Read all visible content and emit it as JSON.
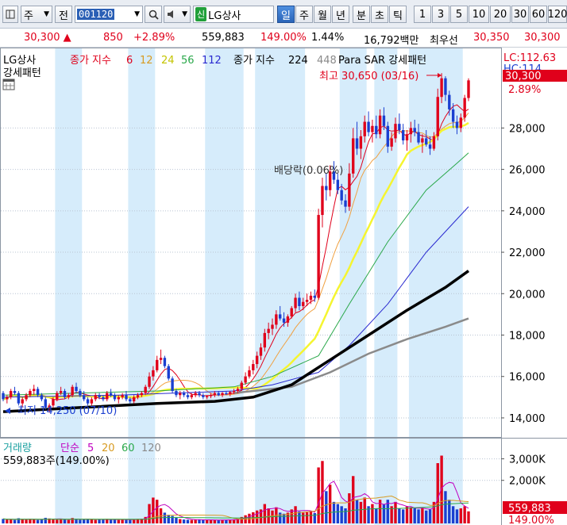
{
  "toolbar": {
    "code_type": "주",
    "prefix_btn": "전",
    "stock_code": "001120",
    "search_icon": "search-icon",
    "sound_icon": "speaker-icon",
    "credit_badge": "신",
    "stock_name": "LG상사",
    "periods": [
      "일",
      "주",
      "월",
      "년",
      "분",
      "초",
      "틱"
    ],
    "active_period": "일",
    "minute_counts": [
      "1",
      "3",
      "5",
      "10",
      "20",
      "30",
      "60",
      "120"
    ]
  },
  "quote": {
    "price": "30,300",
    "change": "850",
    "change_pct": "+2.89%",
    "volume": "559,883",
    "volume_ratio": "149.00%",
    "turnover_pct": "1.44%",
    "amount": "16,792백만",
    "best_ask_label": "최우선",
    "best_ask": "30,350",
    "best_bid": "30,300"
  },
  "colors": {
    "up": "#e0001b",
    "down": "#1a3fd0",
    "band": "#d6ecfb",
    "ma6": "#e0001b",
    "ma12": "#f0a040",
    "ma24": "#f5f530",
    "ma56": "#2aa84a",
    "ma112": "#2a2ad0",
    "ma224": "#000000",
    "ma448": "#8a8a8a"
  },
  "chart_data": [
    {
      "type": "candlestick",
      "title": "LG상사",
      "subtitle": "강세패턴",
      "legend": {
        "close_ma_label": "종가 지수",
        "periods_short": [
          "6",
          "12",
          "24",
          "56",
          "112"
        ],
        "close_ma_label_long": "종가 지수",
        "period_long": "224",
        "period_448": "448",
        "sar_label": "Para SAR 강세패턴"
      },
      "y_axis": {
        "ticks": [
          "28,000",
          "26,000",
          "24,000",
          "22,000",
          "20,000",
          "18,000",
          "16,000",
          "14,000"
        ],
        "range": [
          13500,
          31500
        ]
      },
      "right_labels": {
        "lc": "LC:112.63",
        "hc": "HC:114",
        "price": "30,300",
        "pct": "2.89%"
      },
      "annotations": {
        "high": "최고 30,650 (03/16)",
        "low": "최저 14,250 (07/10)",
        "dividend": "배당락(0.06%)"
      },
      "ohlc": [
        [
          15200,
          15300,
          14800,
          14900
        ],
        [
          14900,
          15100,
          14700,
          15000
        ],
        [
          15000,
          15400,
          14900,
          15300
        ],
        [
          15300,
          15500,
          15100,
          15200
        ],
        [
          15200,
          15300,
          14600,
          14700
        ],
        [
          14700,
          15000,
          14500,
          14900
        ],
        [
          14900,
          15200,
          14800,
          15100
        ],
        [
          15100,
          15400,
          15000,
          15300
        ],
        [
          15300,
          15600,
          15100,
          15400
        ],
        [
          15400,
          15500,
          15000,
          15100
        ],
        [
          15100,
          15200,
          14800,
          14900
        ],
        [
          14900,
          15000,
          14400,
          14500
        ],
        [
          14500,
          14700,
          14250,
          14600
        ],
        [
          14600,
          15000,
          14500,
          14900
        ],
        [
          14900,
          15300,
          14800,
          15200
        ],
        [
          15200,
          15500,
          15100,
          15300
        ],
        [
          15300,
          15400,
          14900,
          15000
        ],
        [
          15000,
          15200,
          14900,
          15100
        ],
        [
          15100,
          15600,
          15000,
          15500
        ],
        [
          15500,
          15700,
          15200,
          15300
        ],
        [
          15300,
          15400,
          15000,
          15100
        ],
        [
          15100,
          15300,
          14800,
          14900
        ],
        [
          14900,
          15000,
          14600,
          14700
        ],
        [
          14700,
          15000,
          14600,
          14900
        ],
        [
          14900,
          15200,
          14800,
          15100
        ],
        [
          15100,
          15200,
          14900,
          15000
        ],
        [
          15000,
          15100,
          14800,
          14900
        ],
        [
          14900,
          15300,
          14800,
          15200
        ],
        [
          15200,
          15400,
          15000,
          15100
        ],
        [
          15100,
          15200,
          14800,
          14900
        ],
        [
          14900,
          15100,
          14700,
          15000
        ],
        [
          15000,
          15200,
          14900,
          15100
        ],
        [
          15100,
          15300,
          14800,
          14900
        ],
        [
          14900,
          15000,
          14700,
          14800
        ],
        [
          14800,
          15100,
          14700,
          15000
        ],
        [
          15000,
          15200,
          14900,
          15100
        ],
        [
          15100,
          15300,
          15000,
          15200
        ],
        [
          15200,
          15600,
          15100,
          15500
        ],
        [
          15500,
          16200,
          15400,
          16000
        ],
        [
          16000,
          16500,
          15800,
          16300
        ],
        [
          16300,
          17000,
          16200,
          16800
        ],
        [
          16800,
          17300,
          16600,
          16900
        ],
        [
          16900,
          17000,
          16400,
          16500
        ],
        [
          16500,
          16600,
          15800,
          15900
        ],
        [
          15900,
          16000,
          15200,
          15300
        ],
        [
          15300,
          15400,
          15000,
          15100
        ],
        [
          15100,
          15300,
          14900,
          15200
        ],
        [
          15200,
          15300,
          15000,
          15100
        ],
        [
          15100,
          15200,
          14900,
          15000
        ],
        [
          15000,
          15200,
          14900,
          15100
        ],
        [
          15100,
          15300,
          15000,
          15200
        ],
        [
          15200,
          15300,
          15000,
          15100
        ],
        [
          15100,
          15200,
          14900,
          15000
        ],
        [
          15000,
          15100,
          14900,
          15050
        ],
        [
          15050,
          15200,
          14950,
          15100
        ],
        [
          15100,
          15300,
          15000,
          15200
        ],
        [
          15200,
          15300,
          15050,
          15100
        ],
        [
          15100,
          15250,
          15000,
          15200
        ],
        [
          15200,
          15300,
          15100,
          15150
        ],
        [
          15150,
          15300,
          15050,
          15250
        ],
        [
          15250,
          15400,
          15150,
          15300
        ],
        [
          15300,
          15500,
          15200,
          15400
        ],
        [
          15400,
          15800,
          15300,
          15700
        ],
        [
          15700,
          16200,
          15600,
          16000
        ],
        [
          16000,
          16500,
          15900,
          16300
        ],
        [
          16300,
          16800,
          16100,
          16600
        ],
        [
          16600,
          17200,
          16400,
          17000
        ],
        [
          17000,
          17600,
          16800,
          17400
        ],
        [
          17400,
          18300,
          17200,
          18100
        ],
        [
          18100,
          18600,
          17800,
          18300
        ],
        [
          18300,
          18800,
          18000,
          18500
        ],
        [
          18500,
          19200,
          18300,
          19000
        ],
        [
          19000,
          19400,
          18700,
          18800
        ],
        [
          18800,
          19100,
          18400,
          18600
        ],
        [
          18600,
          19000,
          18400,
          18900
        ],
        [
          18900,
          19400,
          18800,
          19300
        ],
        [
          19300,
          20000,
          19100,
          19800
        ],
        [
          19800,
          20100,
          19200,
          19400
        ],
        [
          19400,
          19800,
          19200,
          19600
        ],
        [
          19600,
          20000,
          19400,
          19700
        ],
        [
          19700,
          20100,
          19500,
          19900
        ],
        [
          19900,
          20200,
          19600,
          19800
        ],
        [
          19800,
          24100,
          19700,
          23800
        ],
        [
          23800,
          25600,
          23200,
          25200
        ],
        [
          25200,
          25800,
          24500,
          25000
        ],
        [
          25000,
          26200,
          24700,
          25900
        ],
        [
          25900,
          26400,
          25300,
          25500
        ],
        [
          25500,
          25800,
          24800,
          25000
        ],
        [
          25000,
          25300,
          24300,
          24500
        ],
        [
          24500,
          24800,
          23900,
          24200
        ],
        [
          24200,
          26300,
          24000,
          25800
        ],
        [
          25800,
          28000,
          25600,
          27500
        ],
        [
          27500,
          28300,
          26700,
          27000
        ],
        [
          27000,
          27900,
          26500,
          27600
        ],
        [
          27600,
          28600,
          27300,
          28300
        ],
        [
          28300,
          28800,
          27600,
          27800
        ],
        [
          27800,
          28400,
          27300,
          28100
        ],
        [
          28100,
          28600,
          27500,
          27700
        ],
        [
          27700,
          28900,
          27500,
          28600
        ],
        [
          28600,
          29000,
          27900,
          28100
        ],
        [
          28100,
          28300,
          26800,
          27100
        ],
        [
          27100,
          27800,
          26900,
          27500
        ],
        [
          27500,
          28500,
          27300,
          28200
        ],
        [
          28200,
          28700,
          27700,
          27900
        ],
        [
          27900,
          28200,
          27200,
          27400
        ],
        [
          27400,
          27900,
          26900,
          27700
        ],
        [
          27700,
          28300,
          27300,
          28000
        ],
        [
          28000,
          28400,
          27600,
          27800
        ],
        [
          27800,
          28200,
          27200,
          27300
        ],
        [
          27300,
          27700,
          26800,
          27500
        ],
        [
          27500,
          27900,
          27100,
          27200
        ],
        [
          27200,
          27600,
          26700,
          27000
        ],
        [
          27000,
          27800,
          26900,
          27600
        ],
        [
          27600,
          29900,
          27400,
          29500
        ],
        [
          29500,
          30650,
          29200,
          30400
        ],
        [
          30400,
          30500,
          29300,
          29600
        ],
        [
          29600,
          29800,
          28600,
          28900
        ],
        [
          28900,
          29200,
          28000,
          28300
        ],
        [
          28300,
          28600,
          27700,
          28000
        ],
        [
          28000,
          28700,
          27800,
          28500
        ],
        [
          28500,
          29600,
          28300,
          29450
        ],
        [
          29450,
          30400,
          29300,
          30300
        ]
      ],
      "moving_averages": {
        "ma56": [
          [
            0,
            15100
          ],
          [
            20,
            15200
          ],
          [
            40,
            15300
          ],
          [
            60,
            15500
          ],
          [
            70,
            16000
          ],
          [
            82,
            17000
          ],
          [
            90,
            19500
          ],
          [
            100,
            22500
          ],
          [
            110,
            25000
          ],
          [
            118,
            26300
          ],
          [
            121,
            26800
          ]
        ],
        "ma112": [
          [
            0,
            15000
          ],
          [
            30,
            15100
          ],
          [
            60,
            15300
          ],
          [
            70,
            15600
          ],
          [
            82,
            16200
          ],
          [
            90,
            17500
          ],
          [
            100,
            19500
          ],
          [
            110,
            22000
          ],
          [
            121,
            24200
          ]
        ],
        "ma224": [
          [
            0,
            14300
          ],
          [
            20,
            14500
          ],
          [
            40,
            14700
          ],
          [
            55,
            14800
          ],
          [
            65,
            15000
          ],
          [
            75,
            15600
          ],
          [
            85,
            16800
          ],
          [
            95,
            18000
          ],
          [
            105,
            19200
          ],
          [
            115,
            20300
          ],
          [
            121,
            21100
          ]
        ],
        "ma448": [
          [
            60,
            15200
          ],
          [
            75,
            15500
          ],
          [
            85,
            16200
          ],
          [
            95,
            17100
          ],
          [
            105,
            17800
          ],
          [
            115,
            18400
          ],
          [
            121,
            18800
          ]
        ]
      },
      "band_ranges": [
        [
          14,
          20
        ],
        [
          33,
          39
        ],
        [
          53,
          62
        ],
        [
          66,
          78
        ],
        [
          88,
          94
        ],
        [
          97,
          102
        ],
        [
          106,
          119
        ]
      ]
    },
    {
      "type": "bar",
      "title": "거래량",
      "legend": {
        "simple_label": "단순",
        "periods": [
          "5",
          "20",
          "60",
          "120"
        ]
      },
      "value_label": "559,883주(149.00%)",
      "y_axis": {
        "ticks": [
          "3,000K",
          "2,000K"
        ],
        "range": [
          0,
          3500000
        ]
      },
      "right_labels": {
        "volume": "559,883",
        "pct": "149.00%"
      },
      "values": [
        210000,
        180000,
        200000,
        160000,
        240000,
        190000,
        170000,
        220000,
        180000,
        160000,
        190000,
        260000,
        230000,
        180000,
        170000,
        210000,
        190000,
        160000,
        250000,
        200000,
        170000,
        180000,
        220000,
        190000,
        160000,
        180000,
        170000,
        210000,
        190000,
        180000,
        160000,
        170000,
        190000,
        180000,
        170000,
        210000,
        220000,
        300000,
        900000,
        1200000,
        1100000,
        700000,
        500000,
        400000,
        350000,
        260000,
        200000,
        180000,
        170000,
        160000,
        180000,
        170000,
        160000,
        150000,
        170000,
        160000,
        150000,
        170000,
        160000,
        180000,
        190000,
        220000,
        300000,
        380000,
        450000,
        520000,
        600000,
        650000,
        900000,
        700000,
        600000,
        750000,
        500000,
        450000,
        500000,
        650000,
        800000,
        550000,
        500000,
        520000,
        550000,
        480000,
        2600000,
        2900000,
        1500000,
        1800000,
        1000000,
        900000,
        800000,
        700000,
        1400000,
        2200000,
        1100000,
        1000000,
        1200000,
        800000,
        900000,
        700000,
        1100000,
        900000,
        1100000,
        800000,
        1000000,
        700000,
        650000,
        800000,
        750000,
        700000,
        650000,
        700000,
        600000,
        650000,
        1000000,
        2800000,
        3150000,
        1500000,
        1100000,
        800000,
        650000,
        700000,
        800000,
        560000
      ]
    }
  ]
}
